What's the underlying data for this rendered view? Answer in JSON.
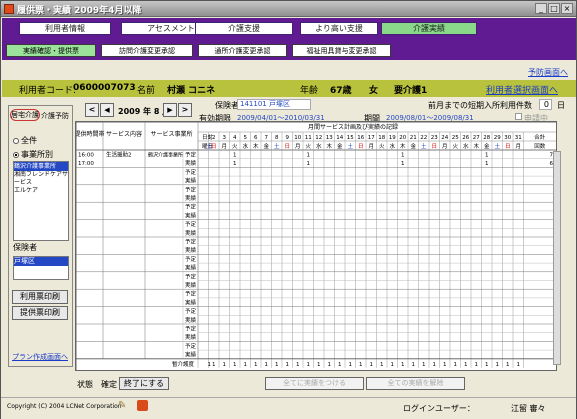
{
  "window": {
    "title": "履供票・実績 2009年4月以降"
  },
  "menu_tabs": [
    {
      "label": "利用者情報",
      "active": false
    },
    {
      "label": "アセスメント",
      "active": false
    },
    {
      "label": "介護支援",
      "active": false
    },
    {
      "label": "より高い支援",
      "active": false
    },
    {
      "label": "介護実績",
      "active": true
    }
  ],
  "sub_buttons": [
    {
      "label": "実績確認・提供票",
      "active": true
    },
    {
      "label": "訪問介護変更承認",
      "active": false
    },
    {
      "label": "通所介護変更承認",
      "active": false
    },
    {
      "label": "福祉用具貸与変更承認",
      "active": false
    }
  ],
  "links": {
    "yoyaku": "予防画面へ",
    "user_select": "利用者選択画面へ",
    "plan": "プラン作成画面へ"
  },
  "user": {
    "code_label": "利用者コード:",
    "code": "0600007073",
    "name_label": "名前",
    "name": "村瀬 コニネ",
    "age_label": "年齢",
    "age": "67歳",
    "sex": "女",
    "care_level": "要介護1"
  },
  "left_panel": {
    "title1": "居宅介護",
    "title2": "介護予防",
    "radio_all": "全件",
    "radio_office": "事業所別",
    "offices": [
      "鶴沢介護事業所",
      "湘南フレンドケアサービス",
      "エルケア"
    ],
    "insurer_label": "保険者",
    "insurer": "戸塚区",
    "btn_usage": "利用票印刷",
    "btn_provide": "提供票印刷"
  },
  "month_nav": {
    "prev": "<",
    "prev_icon": "◀",
    "label": "2009 年 8 月",
    "next_icon": "▶",
    "next": ">"
  },
  "insurance": {
    "insurer_label": "保険者",
    "insurer_no": "141101",
    "insurer_name": "戸塚区",
    "valid_label": "有効期限",
    "valid_range": "2009/04/01〜2010/03/31",
    "period_label": "期間",
    "period_range": "2009/08/01〜2009/08/31",
    "prev_month_label": "前月までの短期入所利用件数",
    "prev_month_value": "0",
    "prev_month_unit": "日",
    "application_label": "申請中"
  },
  "table": {
    "col_time": "提供時間帯",
    "col_service": "サービス内容",
    "col_office": "サービス事業所",
    "caption": "月間サービス計画及び実績の記録",
    "day_label": "日付",
    "weekday_label": "曜日",
    "total_label": "合計",
    "count_label": "回数",
    "days": [
      "1",
      "2",
      "3",
      "4",
      "5",
      "6",
      "7",
      "8",
      "9",
      "10",
      "11",
      "12",
      "13",
      "14",
      "15",
      "16",
      "17",
      "18",
      "19",
      "20",
      "21",
      "22",
      "23",
      "24",
      "25",
      "26",
      "27",
      "28",
      "29",
      "30",
      "31"
    ],
    "weekdays": [
      "土",
      "日",
      "月",
      "火",
      "水",
      "木",
      "金",
      "土",
      "日",
      "月",
      "火",
      "水",
      "木",
      "金",
      "土",
      "日",
      "月",
      "火",
      "水",
      "木",
      "金",
      "土",
      "日",
      "月",
      "火",
      "水",
      "木",
      "金",
      "土",
      "日",
      "月"
    ],
    "row_labels": [
      "予定",
      "実績"
    ],
    "rows": [
      {
        "time": "16:00\n17:00",
        "service": "生活援助2",
        "office": "鶴沢介護事業所",
        "plan": [
          "",
          "",
          "",
          "1",
          "",
          "",
          "",
          "",
          "",
          "",
          "1",
          "",
          "",
          "",
          "",
          "",
          "",
          "",
          "",
          "1",
          "",
          "",
          "",
          "",
          "",
          "",
          "",
          "1",
          "",
          "",
          ""
        ],
        "plan_total": "7",
        "actual": [
          "",
          "",
          "",
          "1",
          "",
          "",
          "",
          "",
          "",
          "",
          "1",
          "",
          "",
          "",
          "",
          "",
          "",
          "",
          "",
          "1",
          "",
          "",
          "",
          "",
          "",
          "",
          "",
          "1",
          "",
          "",
          ""
        ],
        "actual_total": "6"
      }
    ],
    "footer_label": "暫介護度",
    "footer_values": [
      "1",
      "1",
      "1",
      "1",
      "1",
      "1",
      "1",
      "1",
      "1",
      "1",
      "1",
      "1",
      "1",
      "1",
      "1",
      "1",
      "1",
      "1",
      "1",
      "1",
      "1",
      "1",
      "1",
      "1",
      "1",
      "1",
      "1",
      "1",
      "1",
      "1",
      "1"
    ]
  },
  "bottom": {
    "status_label": "状態",
    "status_value": "確定",
    "finish_btn": "終了にする",
    "all_actual_btn": "全てに実績をつける",
    "clear_actual_btn": "全ての実績を解除"
  },
  "statusbar": {
    "copyright": "Copyright (C) 2004 LCNet Corporation",
    "login_label": "ログインユーザー：",
    "login_user": "江留 審々"
  }
}
